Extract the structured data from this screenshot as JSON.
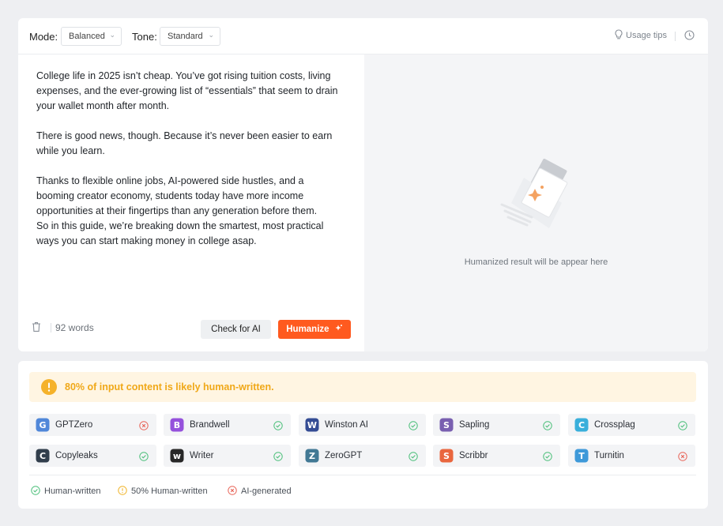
{
  "toolbar": {
    "mode_label": "Mode:",
    "mode_value": "Balanced",
    "tone_label": "Tone:",
    "tone_value": "Standard",
    "usage_tips": "Usage tips"
  },
  "input": {
    "paragraphs": [
      "College life in 2025 isn’t cheap. You’ve got rising tuition costs, living\nexpenses, and the ever-growing list of “essentials” that seem to drain\nyour wallet month after month.",
      "There is good news, though. Because it’s never been easier to earn\nwhile you learn.",
      "Thanks to flexible online jobs, AI-powered side hustles, and a\nbooming creator economy, students today have more income\nopportunities at their fingertips than any generation before them.\nSo in this guide, we’re breaking down the smartest, most practical\nways you can start making money in college asap."
    ],
    "word_count": "92 words",
    "check_button": "Check for AI",
    "humanize_button": "Humanize"
  },
  "output": {
    "placeholder": "Humanized result will be appear here"
  },
  "result": {
    "banner": "80% of input content is likely human-written.",
    "detectors": [
      {
        "name": "GPTZero",
        "status": "ai",
        "logo": "gptzero-logo",
        "color": "#3e7bd6"
      },
      {
        "name": "Brandwell",
        "status": "human",
        "logo": "brandwell-logo",
        "color": "#8b3fd9"
      },
      {
        "name": "Winston AI",
        "status": "human",
        "logo": "winston-logo",
        "color": "#1f3a8a"
      },
      {
        "name": "Sapling",
        "status": "human",
        "logo": "sapling-logo",
        "color": "#6b4fa8"
      },
      {
        "name": "Crossplag",
        "status": "human",
        "logo": "crossplag-logo",
        "color": "#25a7d8"
      },
      {
        "name": "Copyleaks",
        "status": "human",
        "logo": "copyleaks-logo",
        "color": "#1c2a3a"
      },
      {
        "name": "Writer",
        "status": "human",
        "logo": "writer-logo",
        "color": "#111111"
      },
      {
        "name": "ZeroGPT",
        "status": "human",
        "logo": "zerogpt-logo",
        "color": "#2d6a8a"
      },
      {
        "name": "Scribbr",
        "status": "human",
        "logo": "scribbr-logo",
        "color": "#e8562a"
      },
      {
        "name": "Turnitin",
        "status": "ai",
        "logo": "turnitin-logo",
        "color": "#2a8fd6"
      }
    ],
    "legend": {
      "human": "Human-written",
      "half": "50% Human-written",
      "ai": "AI-generated"
    }
  },
  "colors": {
    "accent": "#ff5a1f",
    "human": "#4cbf7a",
    "half": "#f0b429",
    "ai": "#e8665a"
  }
}
